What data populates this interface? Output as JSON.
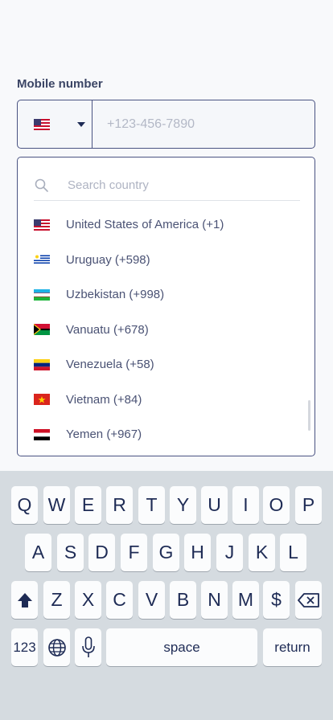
{
  "form": {
    "label": "Mobile number",
    "phone_placeholder": "+123-456-7890"
  },
  "dropdown": {
    "search_placeholder": "Search country",
    "countries": [
      {
        "name": "United States of America (+1)",
        "flag": "us-flag-icon"
      },
      {
        "name": "Uruguay (+598)",
        "flag": "uruguay-flag-icon"
      },
      {
        "name": "Uzbekistan (+998)",
        "flag": "uzbekistan-flag-icon"
      },
      {
        "name": "Vanuatu (+678)",
        "flag": "vanuatu-flag-icon"
      },
      {
        "name": "Venezuela (+58)",
        "flag": "venezuela-flag-icon"
      },
      {
        "name": "Vietnam (+84)",
        "flag": "vietnam-flag-icon"
      },
      {
        "name": "Yemen (+967)",
        "flag": "yemen-flag-icon"
      }
    ]
  },
  "keyboard": {
    "row1": [
      "Q",
      "W",
      "E",
      "R",
      "T",
      "Y",
      "U",
      "I",
      "O",
      "P"
    ],
    "row2": [
      "A",
      "S",
      "D",
      "F",
      "G",
      "H",
      "J",
      "K",
      "L"
    ],
    "row3": [
      "Z",
      "X",
      "C",
      "V",
      "B",
      "N",
      "M",
      "$"
    ],
    "num_key": "123",
    "space": "space",
    "return": "return"
  },
  "colors": {
    "accent_border": "#4a5382",
    "keyboard_bg": "#d5dbe0",
    "key_text": "#1e2b55"
  }
}
